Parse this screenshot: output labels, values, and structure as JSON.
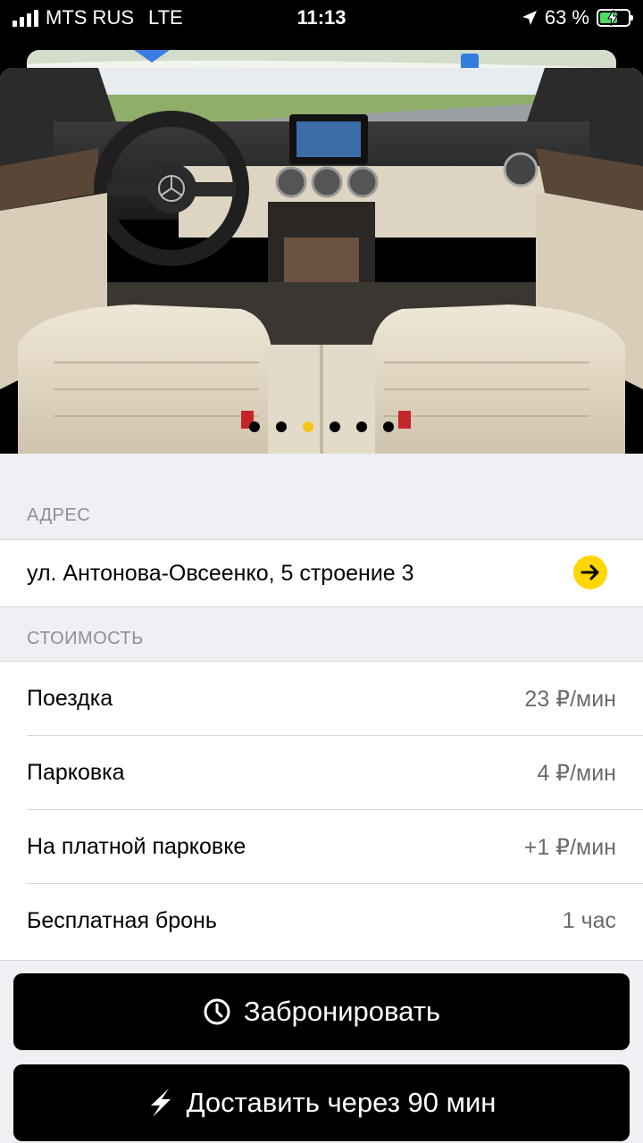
{
  "status": {
    "carrier": "MTS RUS",
    "network": "LTE",
    "time": "11:13",
    "battery": "63 %",
    "battery_level": 0.63
  },
  "gallery": {
    "dot_count": 6,
    "active_index": 2
  },
  "address": {
    "header": "АДРЕС",
    "value": "ул. Антонова-Овсеенко, 5 строение 3"
  },
  "cost": {
    "header": "СТОИМОСТЬ",
    "rows": [
      {
        "label": "Поездка",
        "value": "23 ₽/мин"
      },
      {
        "label": "Парковка",
        "value": "4 ₽/мин"
      },
      {
        "label": "На платной парковке",
        "value": "+1 ₽/мин"
      },
      {
        "label": "Бесплатная бронь",
        "value": "1 час"
      }
    ]
  },
  "actions": {
    "book_label": "Забронировать",
    "deliver_label": "Доставить через 90 мин"
  },
  "colors": {
    "accent": "#ffd600",
    "active_dot": "#f5c518",
    "battery": "#4cd964"
  }
}
